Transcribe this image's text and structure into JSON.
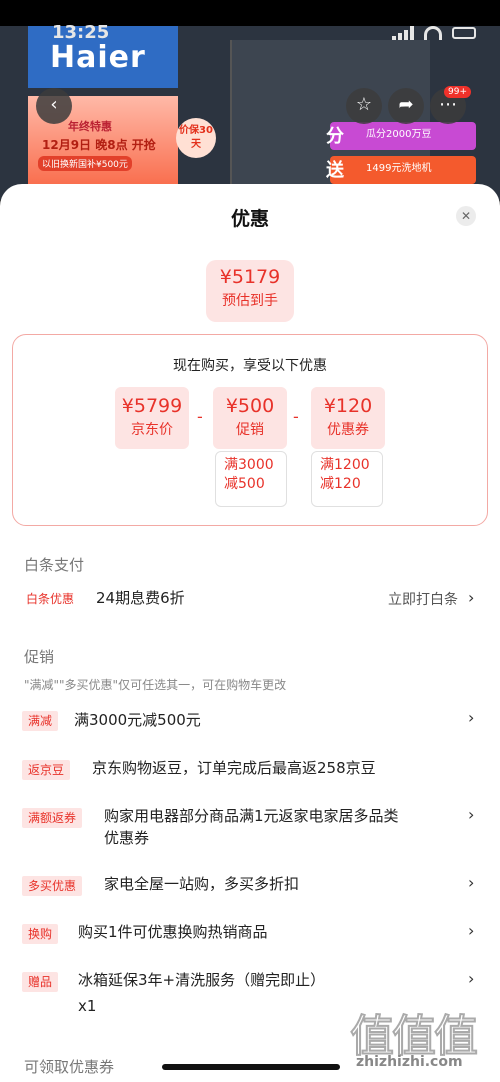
{
  "status_bar": {
    "time": "13:25"
  },
  "background": {
    "brand": "Haier",
    "promo_left": {
      "line1": "年终特惠",
      "line2": "12月9日 晚8点 开抢",
      "line3": "以旧换新国补¥500元"
    },
    "badge_30": "价保30天",
    "promo_right": [
      {
        "tag": "分",
        "text": "瓜分2000万豆"
      },
      {
        "tag": "送",
        "text": "1499元洗地机"
      }
    ],
    "cart_count": "99+"
  },
  "sheet": {
    "title": "优惠",
    "close_icon": "close-icon",
    "estimate": {
      "price": "¥5179",
      "label": "预估到手"
    },
    "calc": {
      "caption": "现在购买，享受以下优惠",
      "items": [
        {
          "amount": "¥5799",
          "label": "京东价"
        },
        {
          "amount": "¥500",
          "label": "促销",
          "cond1": "满3000",
          "cond2": "减500"
        },
        {
          "amount": "¥120",
          "label": "优惠券",
          "cond1": "满1200",
          "cond2": "减120"
        }
      ],
      "minus": "-"
    },
    "baitiao": {
      "section_title": "白条支付",
      "tag": "白条优惠",
      "text": "24期息费6折",
      "link": "立即打白条"
    },
    "promo": {
      "section_title": "促销",
      "note": "\"满减\"\"多买优惠\"仅可任选其一，可在购物车更改",
      "rows": [
        {
          "tag": "满减",
          "line1": "满3000元减500元",
          "line2": ""
        },
        {
          "tag": "返京豆",
          "line1": "京东购物返豆，订单完成后最高返258京豆",
          "line2": ""
        },
        {
          "tag": "满额返券",
          "line1": "购家用电器部分商品满1元返家电家居多品类",
          "line2": "优惠券"
        },
        {
          "tag": "多买优惠",
          "line1": "家电全屋一站购，多买多折扣",
          "line2": ""
        },
        {
          "tag": "换购",
          "line1": "购买1件可优惠换购热销商品",
          "line2": ""
        },
        {
          "tag": "赠品",
          "line1": "冰箱延保3年+清洗服务（赠完即止）",
          "line2": "x1"
        }
      ]
    },
    "coupons": {
      "section_title": "可领取优惠券"
    }
  },
  "watermark": {
    "glyphs": "值值值",
    "url": "zhizhizhi.com"
  },
  "colors": {
    "accent": "#e8322a",
    "tag_bg": "#fde4e3",
    "box_border": "#f3a9a4"
  }
}
